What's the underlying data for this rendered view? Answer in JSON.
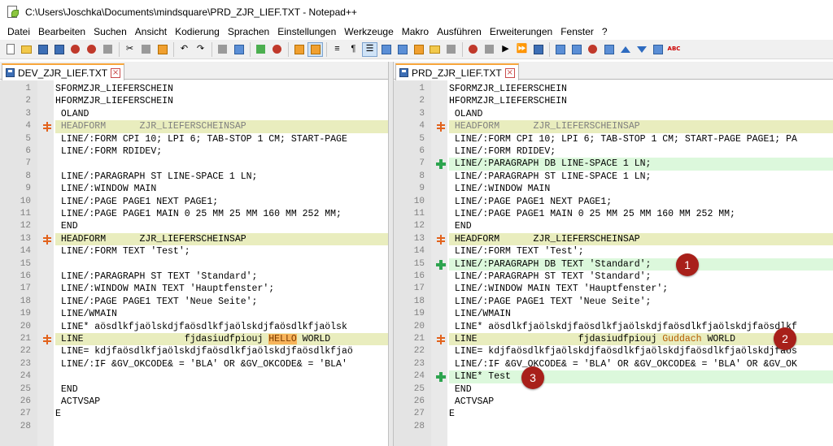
{
  "window": {
    "title": "C:\\Users\\Joschka\\Documents\\mindsquare\\PRD_ZJR_LIEF.TXT - Notepad++"
  },
  "menu": [
    "Datei",
    "Bearbeiten",
    "Suchen",
    "Ansicht",
    "Kodierung",
    "Sprachen",
    "Einstellungen",
    "Werkzeuge",
    "Makro",
    "Ausführen",
    "Erweiterungen",
    "Fenster",
    "?"
  ],
  "colors": {
    "changed_line": "#e9edbe",
    "added_line": "#dcf8dc",
    "blank_line": "#e0e0e0",
    "changed_marker": "#e2631d",
    "added_marker": "#2ea44f",
    "tab_accent": "#f7a53b",
    "callout": "#a8201a"
  },
  "left": {
    "tab_label": "DEV_ZJR_LIEF.TXT",
    "lines": [
      {
        "n": "1",
        "text": "SFORMZJR_LIEFERSCHEIN",
        "state": ""
      },
      {
        "n": "2",
        "text": "HFORMZJR_LIEFERSCHEIN",
        "state": ""
      },
      {
        "n": "3",
        "text": " OLAND",
        "state": ""
      },
      {
        "n": "4",
        "text": " HEADFORM      ZJR_LIEFERSCHEINSAP",
        "state": "changed dim"
      },
      {
        "n": "5",
        "text": " LINE/:FORM CPI 10; LPI 6; TAB-STOP 1 CM; START-PAGE",
        "state": ""
      },
      {
        "n": "6",
        "text": " LINE/:FORM RDIDEV;",
        "state": ""
      },
      {
        "n": "7",
        "text": "",
        "state": "blank"
      },
      {
        "n": "8",
        "text": " LINE/:PARAGRAPH ST LINE-SPACE 1 LN;",
        "state": ""
      },
      {
        "n": "9",
        "text": " LINE/:WINDOW MAIN",
        "state": ""
      },
      {
        "n": "10",
        "text": " LINE/:PAGE PAGE1 NEXT PAGE1;",
        "state": ""
      },
      {
        "n": "11",
        "text": " LINE/:PAGE PAGE1 MAIN 0 25 MM 25 MM 160 MM 252 MM;",
        "state": ""
      },
      {
        "n": "12",
        "text": " END",
        "state": ""
      },
      {
        "n": "13",
        "text": " HEADFORM      ZJR_LIEFERSCHEINSAP",
        "state": "changed"
      },
      {
        "n": "14",
        "text": " LINE/:FORM TEXT 'Test';",
        "state": ""
      },
      {
        "n": "15",
        "text": "",
        "state": "blank"
      },
      {
        "n": "16",
        "text": " LINE/:PARAGRAPH ST TEXT 'Standard';",
        "state": ""
      },
      {
        "n": "17",
        "text": " LINE/:WINDOW MAIN TEXT 'Hauptfenster';",
        "state": ""
      },
      {
        "n": "18",
        "text": " LINE/:PAGE PAGE1 TEXT 'Neue Seite';",
        "state": ""
      },
      {
        "n": "19",
        "text": " LINE/WMAIN",
        "state": ""
      },
      {
        "n": "20",
        "text": " LINE* aösdlkfjaölskdjfaösdlkfjaölskdjfaösdlkfjaölsk",
        "state": ""
      },
      {
        "n": "21",
        "text": " LINE                  fjdasiudfpiouj ",
        "hl": "HELLO",
        "after": " WORLD",
        "state": "changed"
      },
      {
        "n": "22",
        "text": " LINE= kdjfaösdlkfjaölskdjfaösdlkfjaölskdjfaösdlkfjaö",
        "state": ""
      },
      {
        "n": "23",
        "text": " LINE/:IF &GV_OKCODE& = 'BLA' OR &GV_OKCODE& = 'BLA'",
        "state": ""
      },
      {
        "n": "24",
        "text": "",
        "state": "blank"
      },
      {
        "n": "25",
        "text": " END",
        "state": ""
      },
      {
        "n": "26",
        "text": " ACTVSAP",
        "state": ""
      },
      {
        "n": "27",
        "text": "E",
        "state": ""
      },
      {
        "n": "28",
        "text": "",
        "state": ""
      }
    ]
  },
  "right": {
    "tab_label": "PRD_ZJR_LIEF.TXT",
    "lines": [
      {
        "n": "1",
        "text": "SFORMZJR_LIEFERSCHEIN",
        "state": ""
      },
      {
        "n": "2",
        "text": "HFORMZJR_LIEFERSCHEIN",
        "state": ""
      },
      {
        "n": "3",
        "text": " OLAND",
        "state": ""
      },
      {
        "n": "4",
        "text": " HEADFORM      ZJR_LIEFERSCHEINSAP",
        "state": "changed dim"
      },
      {
        "n": "5",
        "text": " LINE/:FORM CPI 10; LPI 6; TAB-STOP 1 CM; START-PAGE PAGE1; PA",
        "state": ""
      },
      {
        "n": "6",
        "text": " LINE/:FORM RDIDEV;",
        "state": ""
      },
      {
        "n": "7",
        "text": " LINE/:PARAGRAPH DB LINE-SPACE 1 LN;",
        "state": "added"
      },
      {
        "n": "8",
        "text": " LINE/:PARAGRAPH ST LINE-SPACE 1 LN;",
        "state": ""
      },
      {
        "n": "9",
        "text": " LINE/:WINDOW MAIN",
        "state": ""
      },
      {
        "n": "10",
        "text": " LINE/:PAGE PAGE1 NEXT PAGE1;",
        "state": ""
      },
      {
        "n": "11",
        "text": " LINE/:PAGE PAGE1 MAIN 0 25 MM 25 MM 160 MM 252 MM;",
        "state": ""
      },
      {
        "n": "12",
        "text": " END",
        "state": ""
      },
      {
        "n": "13",
        "text": " HEADFORM      ZJR_LIEFERSCHEINSAP",
        "state": "changed"
      },
      {
        "n": "14",
        "text": " LINE/:FORM TEXT 'Test';",
        "state": ""
      },
      {
        "n": "15",
        "text": " LINE/:PARAGRAPH DB TEXT 'Standard';",
        "state": "added"
      },
      {
        "n": "16",
        "text": " LINE/:PARAGRAPH ST TEXT 'Standard';",
        "state": ""
      },
      {
        "n": "17",
        "text": " LINE/:WINDOW MAIN TEXT 'Hauptfenster';",
        "state": ""
      },
      {
        "n": "18",
        "text": " LINE/:PAGE PAGE1 TEXT 'Neue Seite';",
        "state": ""
      },
      {
        "n": "19",
        "text": " LINE/WMAIN",
        "state": ""
      },
      {
        "n": "20",
        "text": " LINE* aösdlkfjaölskdjfaösdlkfjaölskdjfaösdlkfjaölskdjfaösdlkf",
        "state": ""
      },
      {
        "n": "21",
        "text": " LINE                  fjdasiudfpiouj ",
        "hl": "Guddach",
        "after": " WORLD",
        "state": "changed"
      },
      {
        "n": "22",
        "text": " LINE= kdjfaösdlkfjaölskdjfaösdlkfjaölskdjfaösdlkfjaölskdjfaös",
        "state": ""
      },
      {
        "n": "23",
        "text": " LINE/:IF &GV_OKCODE& = 'BLA' OR &GV_OKCODE& = 'BLA' OR &GV_OK",
        "state": ""
      },
      {
        "n": "24",
        "text": " LINE* Test",
        "state": "added"
      },
      {
        "n": "25",
        "text": " END",
        "state": ""
      },
      {
        "n": "26",
        "text": " ACTVSAP",
        "state": ""
      },
      {
        "n": "27",
        "text": "E",
        "state": ""
      },
      {
        "n": "28",
        "text": "",
        "state": ""
      }
    ]
  },
  "callouts": [
    "1",
    "2",
    "3"
  ]
}
